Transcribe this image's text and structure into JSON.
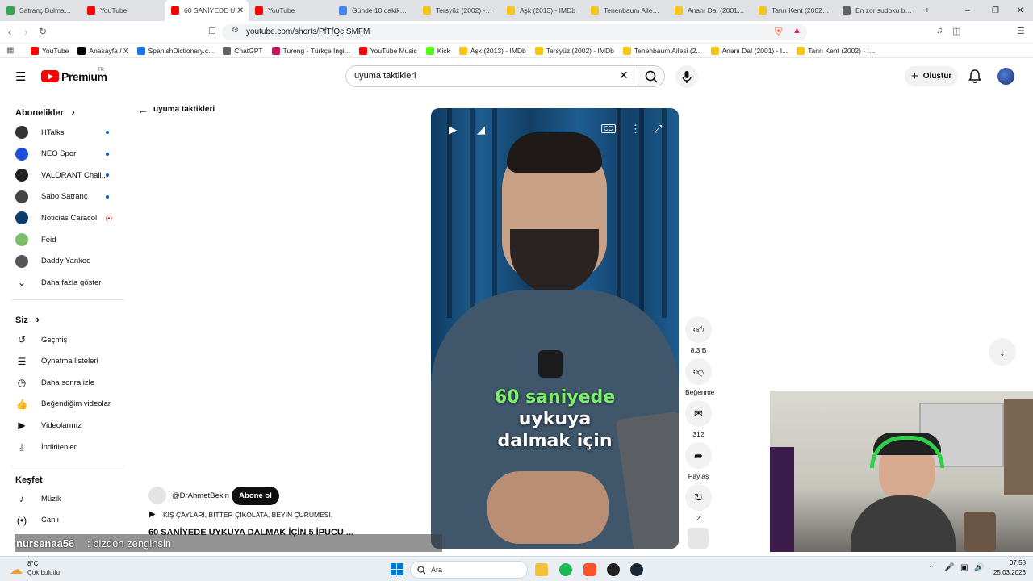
{
  "browser": {
    "tabs": [
      {
        "label": "Satranç Bulmacaları",
        "color": "#34a853"
      },
      {
        "label": "YouTube",
        "color": "#ff0000"
      },
      {
        "label": "60 SANİYEDE U...",
        "color": "#ff0000",
        "active": true
      },
      {
        "label": "YouTube",
        "color": "#ff0000"
      },
      {
        "label": "Günde 10 dakikada",
        "color": "#4285f4"
      },
      {
        "label": "Tersyüz (2002) - IMDb",
        "color": "#f5c518"
      },
      {
        "label": "Aşk (2013) - IMDb",
        "color": "#f5c518"
      },
      {
        "label": "Tenenbaum Ailesi (2...",
        "color": "#f5c518"
      },
      {
        "label": "Ananı Da! (2001) - I...",
        "color": "#f5c518"
      },
      {
        "label": "Tanrı Kent (2002) - I...",
        "color": "#f5c518"
      },
      {
        "label": "En zor sudoku bulm...",
        "color": "#5f6368"
      }
    ],
    "new_tab": "+",
    "url": "youtube.com/shorts/PfTfQcISMFM",
    "bookmarks": [
      {
        "label": "YouTube",
        "color": "#ff0000"
      },
      {
        "label": "Anasayfa / X",
        "color": "#000000"
      },
      {
        "label": "SpanishDictionary.c...",
        "color": "#1a73e8"
      },
      {
        "label": "ChatGPT",
        "color": "#5f6368"
      },
      {
        "label": "Tureng - Türkçe İngi...",
        "color": "#c2185b"
      },
      {
        "label": "YouTube Music",
        "color": "#ff0000"
      },
      {
        "label": "Kick",
        "color": "#53fc18"
      },
      {
        "label": "Aşk (2013) - IMDb",
        "color": "#f5c518"
      },
      {
        "label": "Tersyüz (2002) - IMDb",
        "color": "#f5c518"
      },
      {
        "label": "Tenenbaum Ailesi (2...",
        "color": "#f5c518"
      },
      {
        "label": "Ananı Da! (2001) - I...",
        "color": "#f5c518"
      },
      {
        "label": "Tanrı Kent (2002) - I...",
        "color": "#f5c518"
      }
    ]
  },
  "header": {
    "logo": "Premium",
    "logo_sup": "TR",
    "search_value": "uyuma taktikleri",
    "create_label": "Oluştur"
  },
  "sidebar": {
    "subscriptions_title": "Abonelikler",
    "subscriptions": [
      {
        "label": "HTalks",
        "color": "#333333",
        "badge": "dot"
      },
      {
        "label": "NEO Spor",
        "color": "#1e4fd8",
        "badge": "dot"
      },
      {
        "label": "VALORANT Chall...",
        "color": "#222222",
        "badge": "dot"
      },
      {
        "label": "Sabo Satranç",
        "color": "#444444",
        "badge": "dot"
      },
      {
        "label": "Noticias Caracol",
        "color": "#0b3d6b",
        "badge": "live"
      },
      {
        "label": "Feid",
        "color": "#7bbf6a",
        "badge": ""
      },
      {
        "label": "Daddy Yankee",
        "color": "#555555",
        "badge": ""
      }
    ],
    "show_more": "Daha fazla göster",
    "you_title": "Siz",
    "you_items": [
      "Geçmiş",
      "Oynatma listeleri",
      "Daha sonra izle",
      "Beğendiğim videolar",
      "Videolarınız",
      "İndirilenler"
    ],
    "explore_title": "Keşfet",
    "explore_items": [
      "Müzik",
      "Canlı"
    ]
  },
  "main": {
    "back_label": "uyuma taktikleri",
    "caption_lines": [
      "60 saniyede",
      "uykuya",
      "dalmak için"
    ],
    "channel": "@DrAhmetBekin",
    "subscribe_label": "Abone ol",
    "music_line": "KIŞ ÇAYLARI, BİTTER ÇİKOLATA, BEYİN ÇÜRÜMESİ,",
    "title": "60 SANİYEDE UYKUYA DALMAK İÇİN 5 İPUCU ...",
    "actions": [
      {
        "icon": "thumbs-up-icon",
        "label": "8,3 B"
      },
      {
        "icon": "thumbs-down-icon",
        "label": "Beğenme"
      },
      {
        "icon": "comment-icon",
        "label": "312"
      },
      {
        "icon": "share-icon",
        "label": "Paylaş"
      },
      {
        "icon": "remix-icon",
        "label": "2"
      }
    ]
  },
  "overlay_chat": {
    "user": "nursenaa56",
    "message": ": bizden zenginsin"
  },
  "taskbar": {
    "weather_temp": "8°C",
    "weather_desc": "Çok bulutlu",
    "search_label": "Ara",
    "time": "07:58",
    "date": "25.03.2026"
  }
}
